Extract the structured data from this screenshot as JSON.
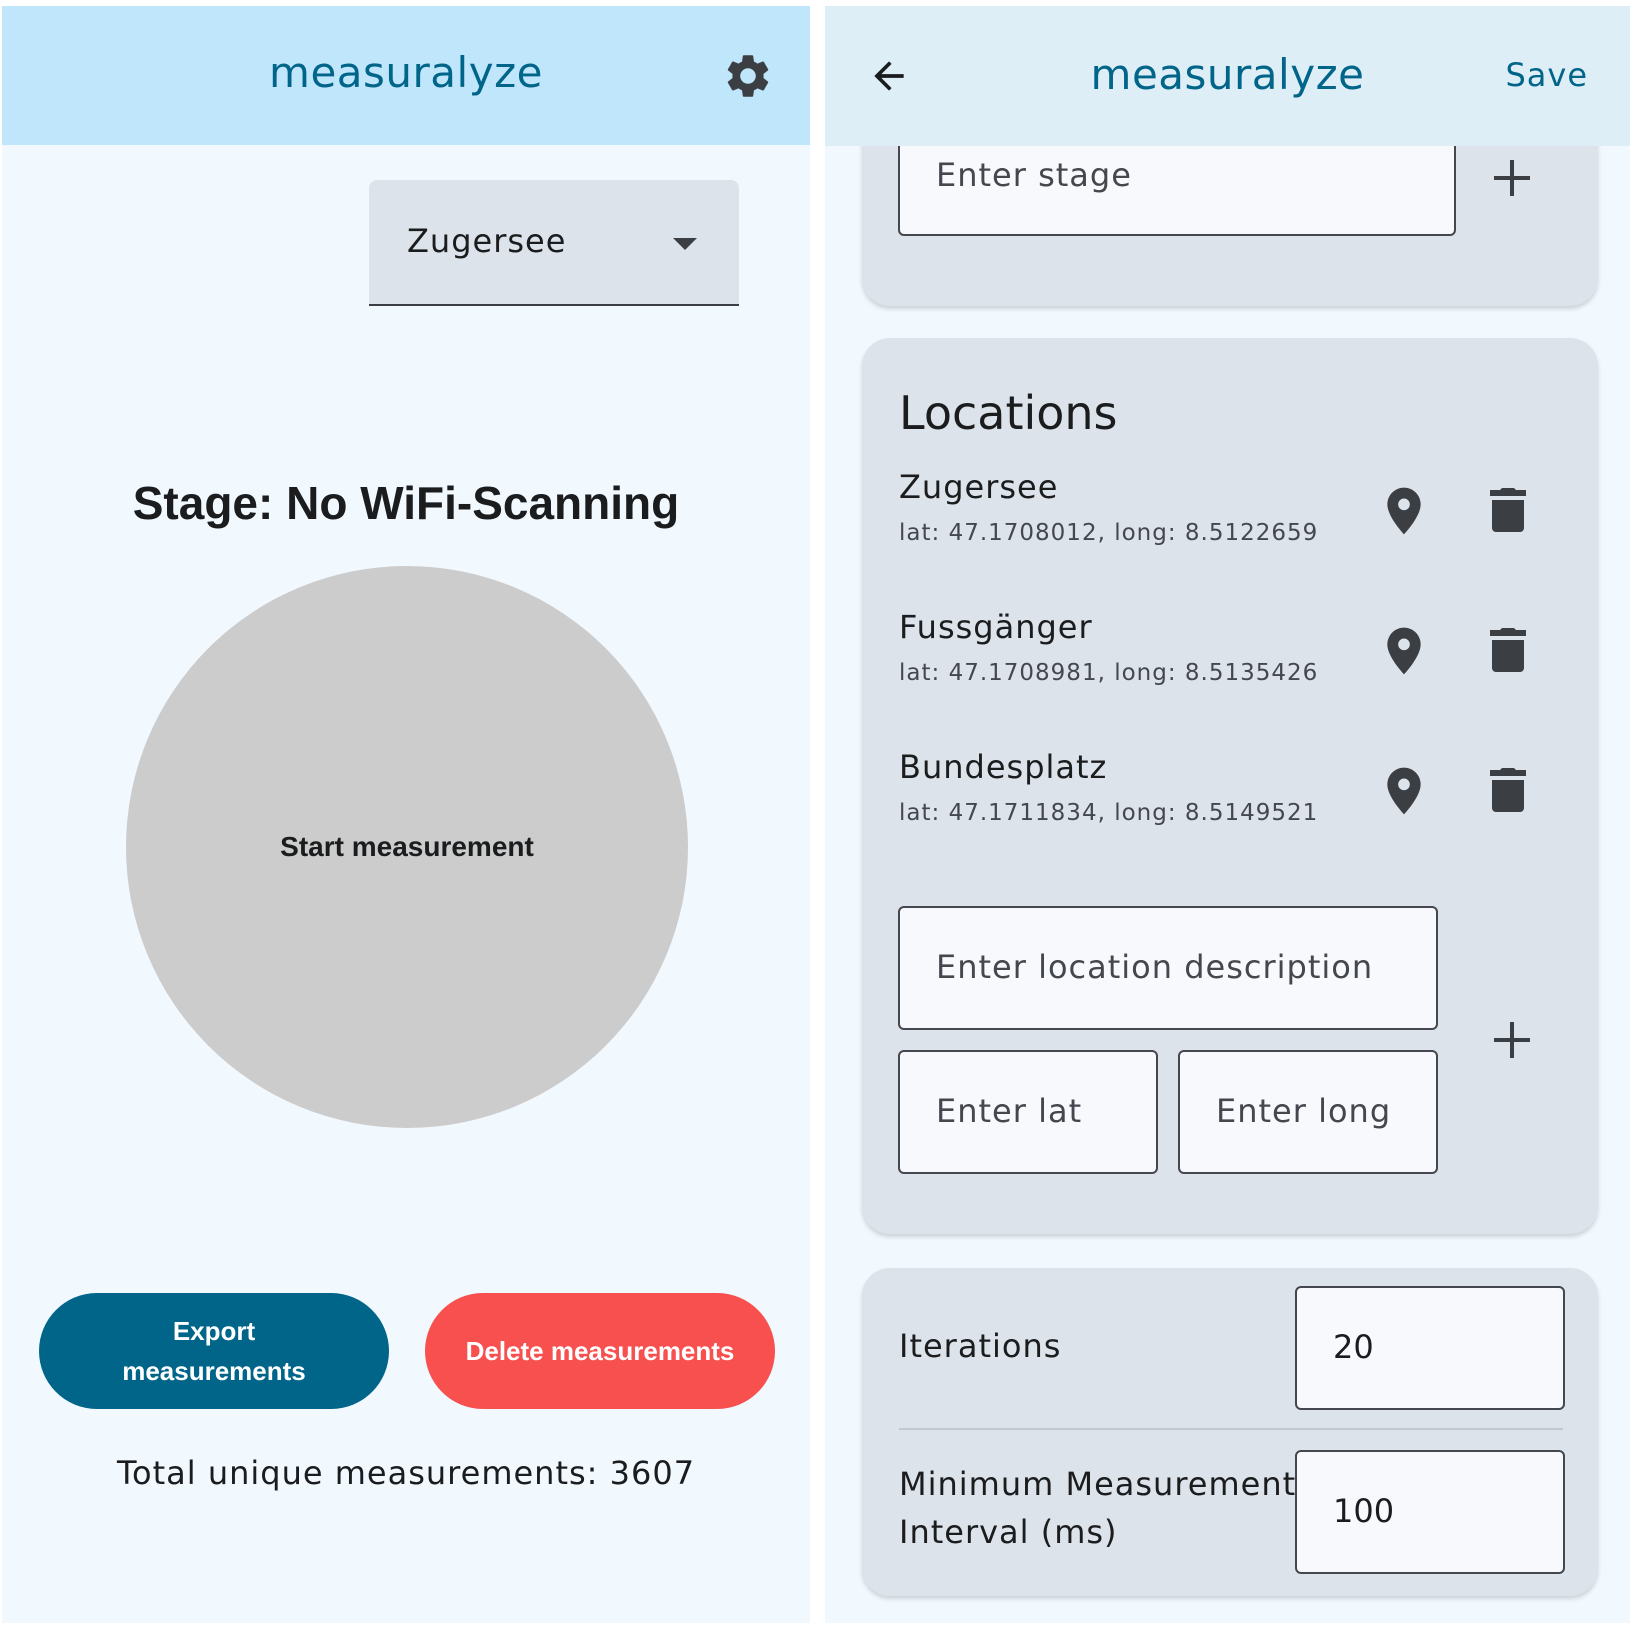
{
  "left": {
    "app_title": "measuralyze",
    "settings_icon": "gear-icon",
    "location_select": {
      "value": "Zugersee",
      "icon": "dropdown-arrow-icon"
    },
    "stage_heading": "Stage: No WiFi-Scanning",
    "start_button_label": "Start measurement",
    "export_button_label": "Export measurements",
    "delete_button_label": "Delete measurements",
    "total_text": "Total unique measurements: 3607"
  },
  "right": {
    "back_icon": "arrow-left-icon",
    "app_title": "measuralyze",
    "save_label": "Save",
    "stage_input_placeholder": "Enter stage",
    "locations_title": "Locations",
    "locations": [
      {
        "name": "Zugersee",
        "coords": "lat: 47.1708012, long: 8.5122659"
      },
      {
        "name": "Fussgänger",
        "coords": "lat: 47.1708981, long: 8.5135426"
      },
      {
        "name": "Bundesplatz",
        "coords": "lat: 47.1711834, long: 8.5149521"
      }
    ],
    "location_description_placeholder": "Enter location description",
    "lat_placeholder": "Enter lat",
    "long_placeholder": "Enter long",
    "iterations_label": "Iterations",
    "iterations_value": "20",
    "interval_label_line1": "Minimum Measurement",
    "interval_label_line2": "Interval (ms)",
    "interval_value": "100"
  },
  "colors": {
    "primary": "#006589",
    "danger": "#f84f4f",
    "left_topbar": "#c0e6fc",
    "right_topbar": "#deeef6",
    "card": "#dde3ea",
    "background": "#f1f8fe"
  }
}
